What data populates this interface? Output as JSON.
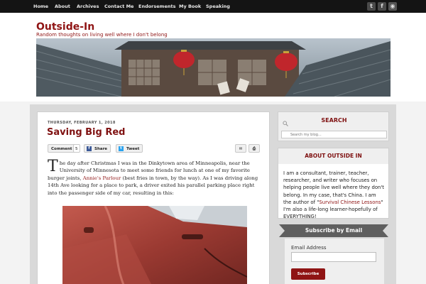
{
  "nav": {
    "items": [
      "Home",
      "About",
      "Archives",
      "Contact Me",
      "Endorsements",
      "My Book",
      "Speaking"
    ]
  },
  "social": {
    "icons": [
      "twitter-icon",
      "facebook-icon",
      "rss-icon"
    ],
    "glyphs": [
      "t",
      "f",
      "◉"
    ]
  },
  "header": {
    "title": "Outside-In",
    "tagline": "Random thoughts on living well where I don't belong"
  },
  "post": {
    "date": "THURSDAY, FEBRUARY 1, 2018",
    "title": "Saving Big Red",
    "share": {
      "comment_label": "Comment",
      "comment_count": "5",
      "share_label": "Share",
      "tweet_label": "Tweet"
    },
    "body": {
      "dropcap": "T",
      "p1": "he day after Christmas I was in the Dinkytown area of Minneapolis, near the University of Minnesota to meet some friends for lunch at one of my favorite burger joints, ",
      "link": "Annie's Parlour",
      "p2": " (best fries in town, by the way). As I was driving along 14th Ave looking for a place to park, a driver exited his parallel parking place right into the passenger side of my car, resulting in this:"
    }
  },
  "sidebar": {
    "search": {
      "heading": "SEARCH",
      "placeholder": "Search my blog..."
    },
    "about": {
      "heading": "ABOUT OUTSIDE IN",
      "text1": "I am a consultant, trainer, teacher, researcher, and writer who focuses on helping people live well where they don't belong. In my case, that's China. I am the author of \"",
      "link": "Survival Chinese Lessons",
      "text2": "\" I'm also a life-long learner-hopefully of EVERYTHING!"
    },
    "subscribe": {
      "heading": "Subscribe by Email",
      "email_label": "Email Address",
      "button": "Subscribe"
    }
  },
  "colors": {
    "accent": "#8f1414",
    "nav_bg": "#141414",
    "ribbon": "#5f5f5f"
  }
}
